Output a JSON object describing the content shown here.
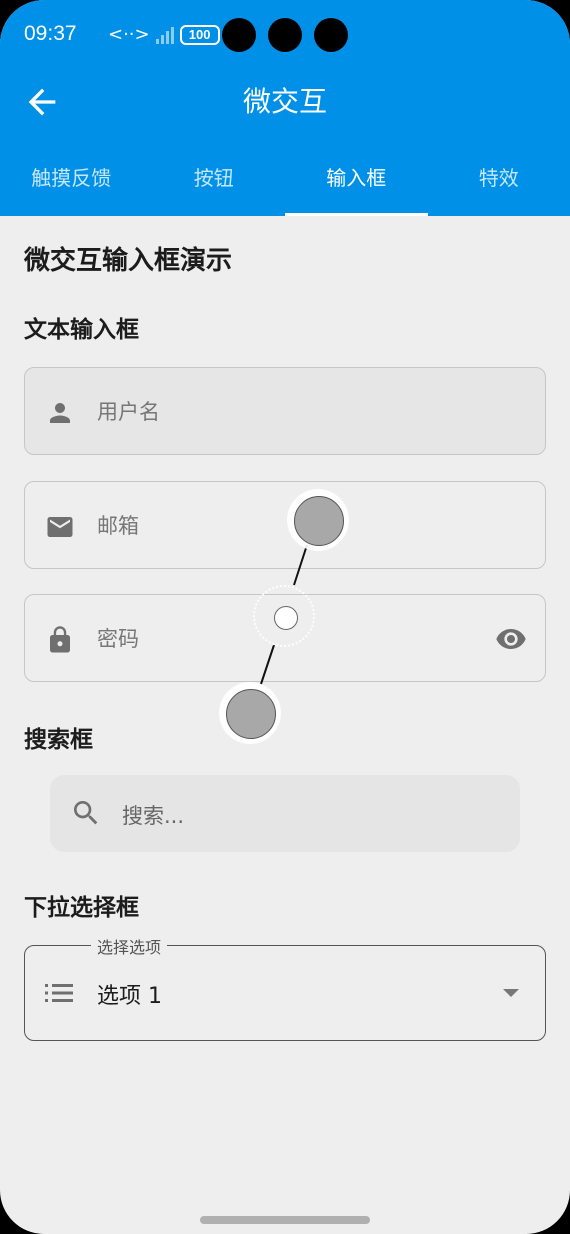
{
  "status_bar": {
    "time": "09:37",
    "battery": "100"
  },
  "app_bar": {
    "title": "微交互"
  },
  "tabs": [
    {
      "label": "触摸反馈"
    },
    {
      "label": "按钮"
    },
    {
      "label": "输入框"
    },
    {
      "label": "特效"
    }
  ],
  "active_tab": "输入框",
  "page": {
    "heading": "微交互输入框演示",
    "text_inputs_section": "文本输入框",
    "username_placeholder": "用户名",
    "email_placeholder": "邮箱",
    "password_placeholder": "密码",
    "search_section": "搜索框",
    "search_placeholder": "搜索...",
    "dropdown_section": "下拉选择框",
    "dropdown_label": "选择选项",
    "dropdown_value": "选项 1"
  },
  "icons": {
    "back": "arrow-left-icon",
    "username": "person-icon",
    "email": "mail-icon",
    "password": "lock-icon",
    "visibility": "eye-icon",
    "search": "search-icon",
    "dropdown_leading": "list-icon",
    "dropdown_trailing": "caret-down-icon"
  },
  "colors": {
    "primary": "#0190e8",
    "background": "#eeeeee",
    "text": "#1c1c1c"
  }
}
